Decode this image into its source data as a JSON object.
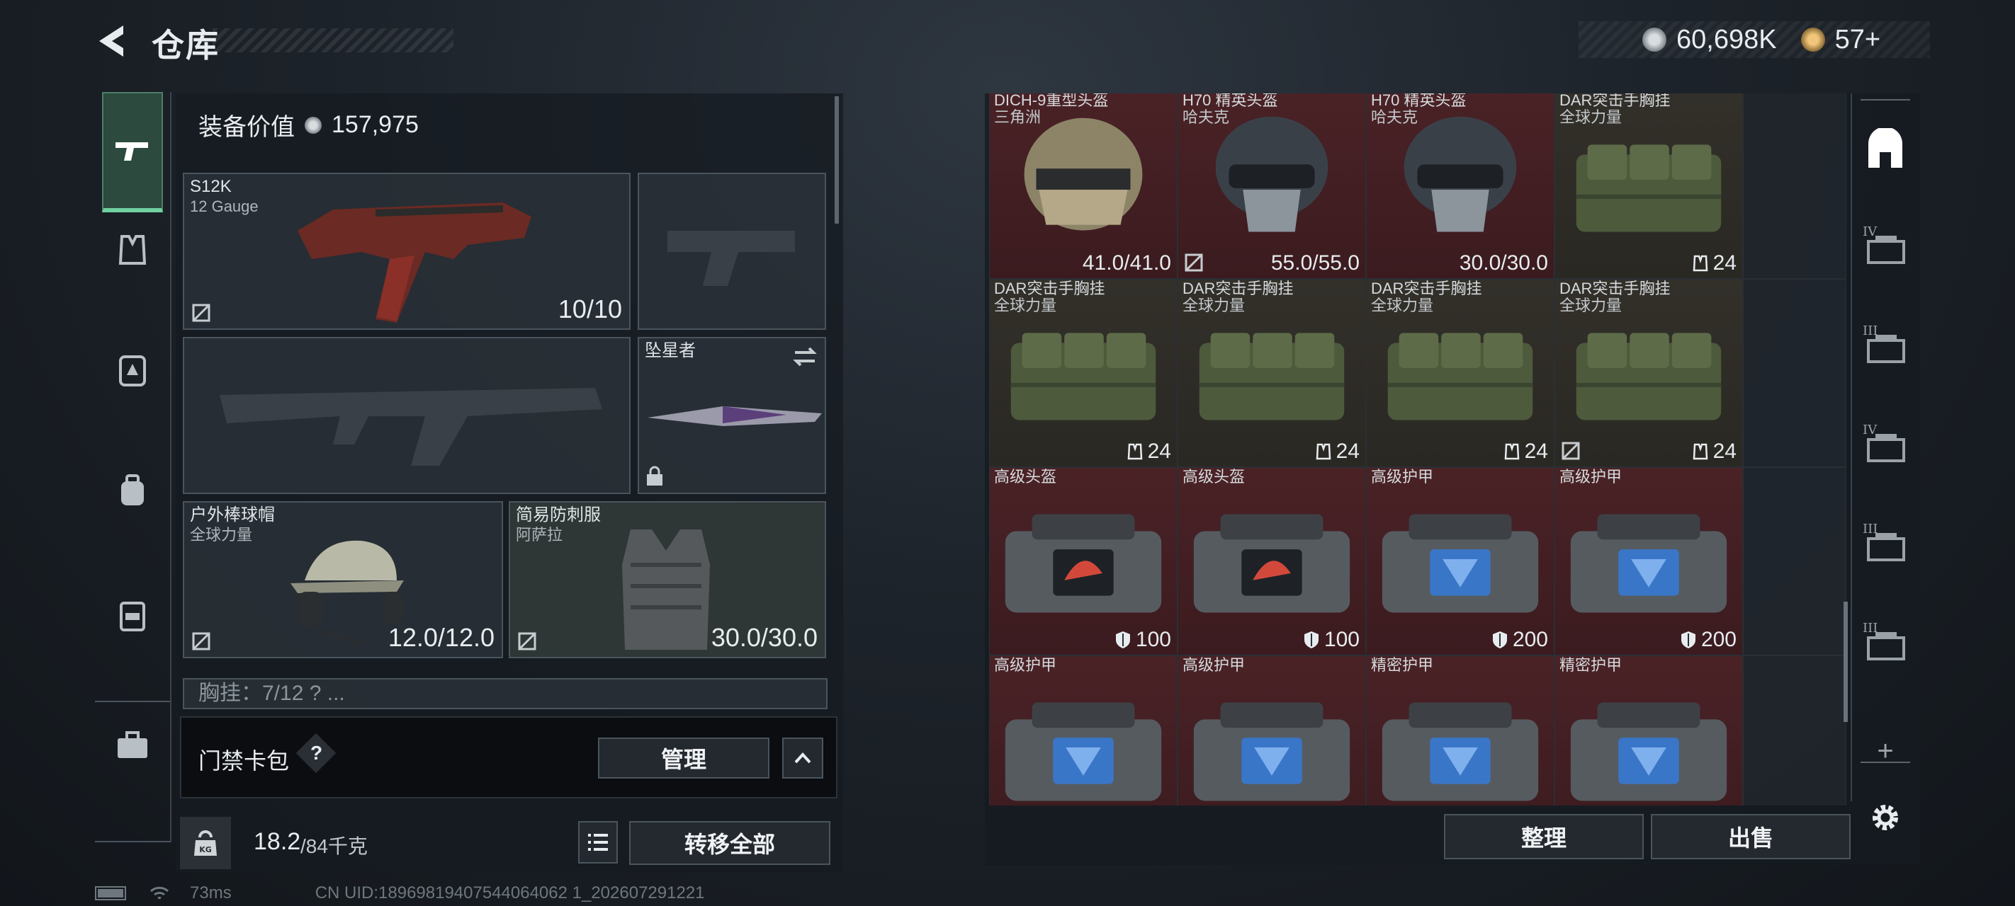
{
  "header": {
    "title": "仓库"
  },
  "currency": {
    "coins": "60,698K",
    "tickets": "57+"
  },
  "loadout": {
    "value_label": "装备价值",
    "value": "157,975",
    "primary_weapon": {
      "name": "S12K",
      "sub": "12 Gauge",
      "durability": "10/10"
    },
    "melee": {
      "name": "坠星者"
    },
    "helmet": {
      "name": "户外棒球帽",
      "sub": "全球力量",
      "durability": "12.0/12.0"
    },
    "armor": {
      "name": "简易防刺服",
      "sub": "阿萨拉",
      "durability": "30.0/30.0"
    },
    "chest_rig": "胸挂：7/12 ? ..."
  },
  "cardpack": {
    "label": "门禁卡包",
    "help": "?",
    "manage": "管理"
  },
  "weight": {
    "value": "18.2",
    "max": "/84千克",
    "transfer_all": "转移全部"
  },
  "grid": {
    "rows": [
      [
        {
          "name": "DICH-9重型头盔",
          "sub": "三角洲",
          "stat": "41.0/41.0",
          "bg": "red",
          "icon": "helmet-tan"
        },
        {
          "name": "H70 精英头盔",
          "sub": "哈夫克",
          "stat": "55.0/55.0",
          "bg": "red",
          "icon": "helmet-dark",
          "nobind": true
        },
        {
          "name": "H70 精英头盔",
          "sub": "哈夫克",
          "stat": "30.0/30.0",
          "bg": "red",
          "icon": "helmet-dark"
        },
        {
          "name": "DAR突击手胸挂",
          "sub": "全球力量",
          "stat": "24",
          "bg": "olive",
          "icon": "rig"
        }
      ],
      [
        {
          "name": "DAR突击手胸挂",
          "sub": "全球力量",
          "stat": "24",
          "bg": "olive",
          "icon": "rig"
        },
        {
          "name": "DAR突击手胸挂",
          "sub": "全球力量",
          "stat": "24",
          "bg": "olive",
          "icon": "rig"
        },
        {
          "name": "DAR突击手胸挂",
          "sub": "全球力量",
          "stat": "24",
          "bg": "olive",
          "icon": "rig"
        },
        {
          "name": "DAR突击手胸挂",
          "sub": "全球力量",
          "stat": "24",
          "bg": "olive",
          "icon": "rig",
          "nobind": true
        }
      ],
      [
        {
          "name": "高级头盔",
          "sub": "",
          "stat": "100",
          "bg": "red",
          "icon": "case-red"
        },
        {
          "name": "高级头盔",
          "sub": "",
          "stat": "100",
          "bg": "red",
          "icon": "case-red"
        },
        {
          "name": "高级护甲",
          "sub": "",
          "stat": "200",
          "bg": "red",
          "icon": "case-blue"
        },
        {
          "name": "高级护甲",
          "sub": "",
          "stat": "200",
          "bg": "red",
          "icon": "case-blue"
        }
      ],
      [
        {
          "name": "高级护甲",
          "sub": "",
          "stat": "",
          "bg": "red",
          "icon": "case-blue"
        },
        {
          "name": "高级护甲",
          "sub": "",
          "stat": "",
          "bg": "red",
          "icon": "case-blue"
        },
        {
          "name": "精密护甲",
          "sub": "",
          "stat": "",
          "bg": "red",
          "icon": "case-blue"
        },
        {
          "name": "精密护甲",
          "sub": "",
          "stat": "",
          "bg": "red",
          "icon": "case-blue"
        }
      ]
    ],
    "sort_label": "整理",
    "sell_label": "出售"
  },
  "right_rail": {
    "tiers": [
      "IV",
      "III",
      "IV",
      "III",
      "III"
    ],
    "add": "+"
  },
  "status": {
    "ping": "73ms",
    "uid": "CN UID:18969819407544064062 1_202607291221"
  }
}
